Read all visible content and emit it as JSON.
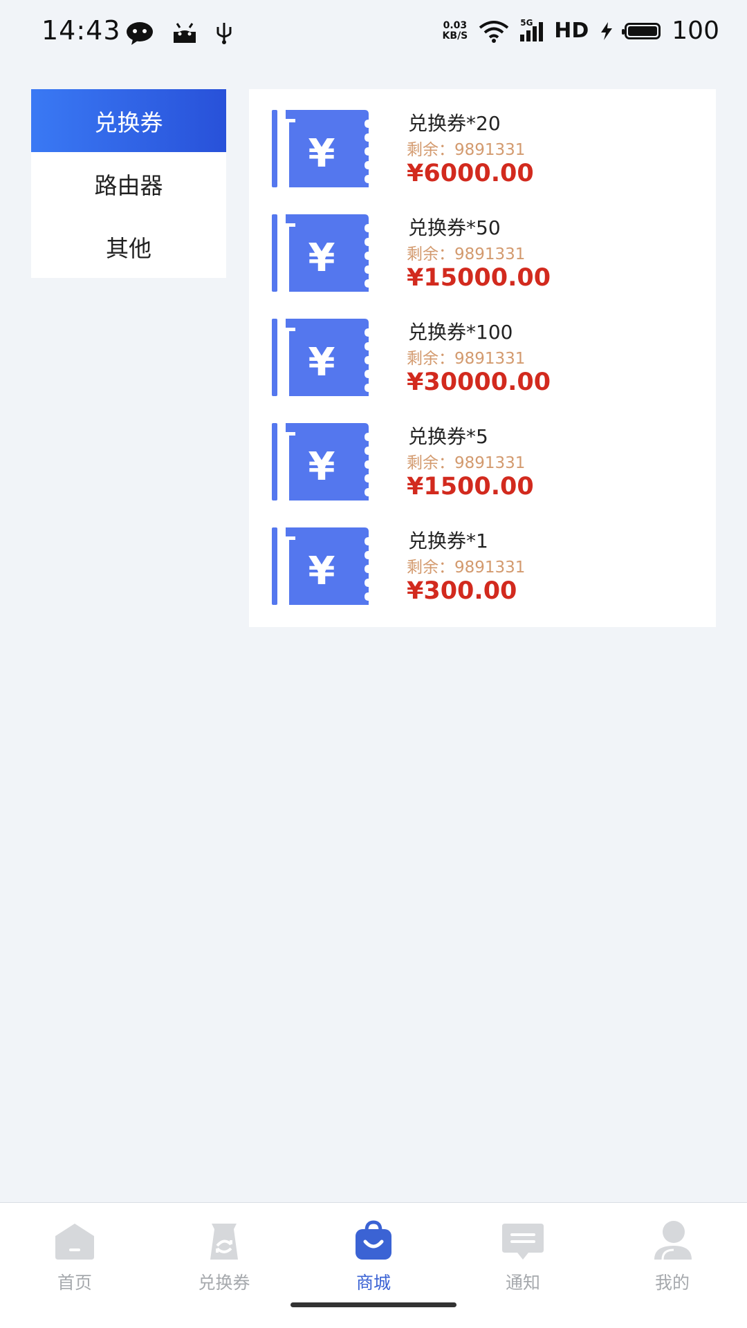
{
  "status_bar": {
    "time": "14:43",
    "net_speed_value": "0.03",
    "net_speed_unit": "KB/S",
    "signal_label": "5G",
    "hd_label": "HD",
    "battery_percent": "100"
  },
  "categories": [
    {
      "label": "兑换券",
      "active": true
    },
    {
      "label": "路由器",
      "active": false
    },
    {
      "label": "其他",
      "active": false
    }
  ],
  "products": [
    {
      "name": "兑换券*20",
      "stock": "剩余：9891331",
      "price": "¥6000.00"
    },
    {
      "name": "兑换券*50",
      "stock": "剩余：9891331",
      "price": "¥15000.00"
    },
    {
      "name": "兑换券*100",
      "stock": "剩余：9891331",
      "price": "¥30000.00"
    },
    {
      "name": "兑换券*5",
      "stock": "剩余：9891331",
      "price": "¥1500.00"
    },
    {
      "name": "兑换券*1",
      "stock": "剩余：9891331",
      "price": "¥300.00"
    }
  ],
  "bottom_nav": [
    {
      "label": "首页",
      "icon": "home-icon",
      "active": false
    },
    {
      "label": "兑换券",
      "icon": "coupon-icon",
      "active": false
    },
    {
      "label": "商城",
      "icon": "shopping-bag-icon",
      "active": true
    },
    {
      "label": "通知",
      "icon": "message-icon",
      "active": false
    },
    {
      "label": "我的",
      "icon": "user-icon",
      "active": false
    }
  ],
  "colors": {
    "accent": "#3b63d4",
    "coupon_icon": "#5477ee",
    "price": "#d22a1e",
    "stock": "#d39a6e",
    "background": "#f1f4f8"
  }
}
